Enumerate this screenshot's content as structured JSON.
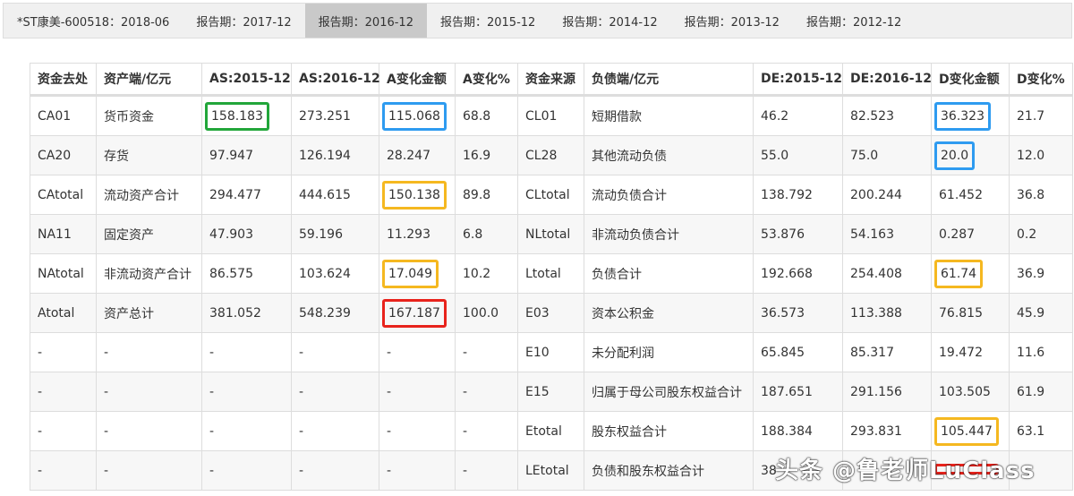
{
  "tabs": [
    {
      "label": "*ST康美-600518：2018-06",
      "active": false
    },
    {
      "label": "报告期：2017-12",
      "active": false
    },
    {
      "label": "报告期：2016-12",
      "active": true
    },
    {
      "label": "报告期：2015-12",
      "active": false
    },
    {
      "label": "报告期：2014-12",
      "active": false
    },
    {
      "label": "报告期：2013-12",
      "active": false
    },
    {
      "label": "报告期：2012-12",
      "active": false
    }
  ],
  "table": {
    "headers": [
      "资金去处",
      "资产端/亿元",
      "AS:2015-12",
      "AS:2016-12",
      "A变化金额",
      "A变化%",
      "资金来源",
      "负债端/亿元",
      "DE:2015-12",
      "DE:2016-12",
      "D变化金额",
      "D变化%"
    ],
    "rows": [
      [
        "CA01",
        "货币资金",
        "158.183",
        "273.251",
        "115.068",
        "68.8",
        "CL01",
        "短期借款",
        "46.2",
        "82.523",
        "36.323",
        "21.7"
      ],
      [
        "CA20",
        "存货",
        "97.947",
        "126.194",
        "28.247",
        "16.9",
        "CL28",
        "其他流动负债",
        "55.0",
        "75.0",
        "20.0",
        "12.0"
      ],
      [
        "CAtotal",
        "流动资产合计",
        "294.477",
        "444.615",
        "150.138",
        "89.8",
        "CLtotal",
        "流动负债合计",
        "138.792",
        "200.244",
        "61.452",
        "36.8"
      ],
      [
        "NA11",
        "固定资产",
        "47.903",
        "59.196",
        "11.293",
        "6.8",
        "NLtotal",
        "非流动负债合计",
        "53.876",
        "54.163",
        "0.287",
        "0.2"
      ],
      [
        "NAtotal",
        "非流动资产合计",
        "86.575",
        "103.624",
        "17.049",
        "10.2",
        "Ltotal",
        "负债合计",
        "192.668",
        "254.408",
        "61.74",
        "36.9"
      ],
      [
        "Atotal",
        "资产总计",
        "381.052",
        "548.239",
        "167.187",
        "100.0",
        "E03",
        "资本公积金",
        "36.573",
        "113.388",
        "76.815",
        "45.9"
      ],
      [
        "-",
        "-",
        "-",
        "-",
        "-",
        "-",
        "E10",
        "未分配利润",
        "65.845",
        "85.317",
        "19.472",
        "11.6"
      ],
      [
        "-",
        "-",
        "-",
        "-",
        "-",
        "-",
        "E15",
        "归属于母公司股东权益合计",
        "187.651",
        "291.156",
        "103.505",
        "61.9"
      ],
      [
        "-",
        "-",
        "-",
        "-",
        "-",
        "-",
        "Etotal",
        "股东权益合计",
        "188.384",
        "293.831",
        "105.447",
        "63.1"
      ],
      [
        "-",
        "-",
        "-",
        "-",
        "-",
        "-",
        "LEtotal",
        "负债和股东权益合计",
        "38",
        "",
        "",
        ""
      ]
    ],
    "highlights": [
      {
        "row": 0,
        "col": 2,
        "color": "#22a63a"
      },
      {
        "row": 0,
        "col": 4,
        "color": "#2e9bf0"
      },
      {
        "row": 0,
        "col": 10,
        "color": "#2e9bf0"
      },
      {
        "row": 1,
        "col": 10,
        "color": "#2e9bf0"
      },
      {
        "row": 2,
        "col": 4,
        "color": "#f5b820"
      },
      {
        "row": 4,
        "col": 4,
        "color": "#f5b820"
      },
      {
        "row": 4,
        "col": 10,
        "color": "#f5b820"
      },
      {
        "row": 5,
        "col": 4,
        "color": "#e8231c"
      },
      {
        "row": 8,
        "col": 10,
        "color": "#f5b820"
      },
      {
        "row": 9,
        "col": 10,
        "color": "#e8231c"
      }
    ]
  },
  "watermark": "头条 @鲁老师LuClass"
}
